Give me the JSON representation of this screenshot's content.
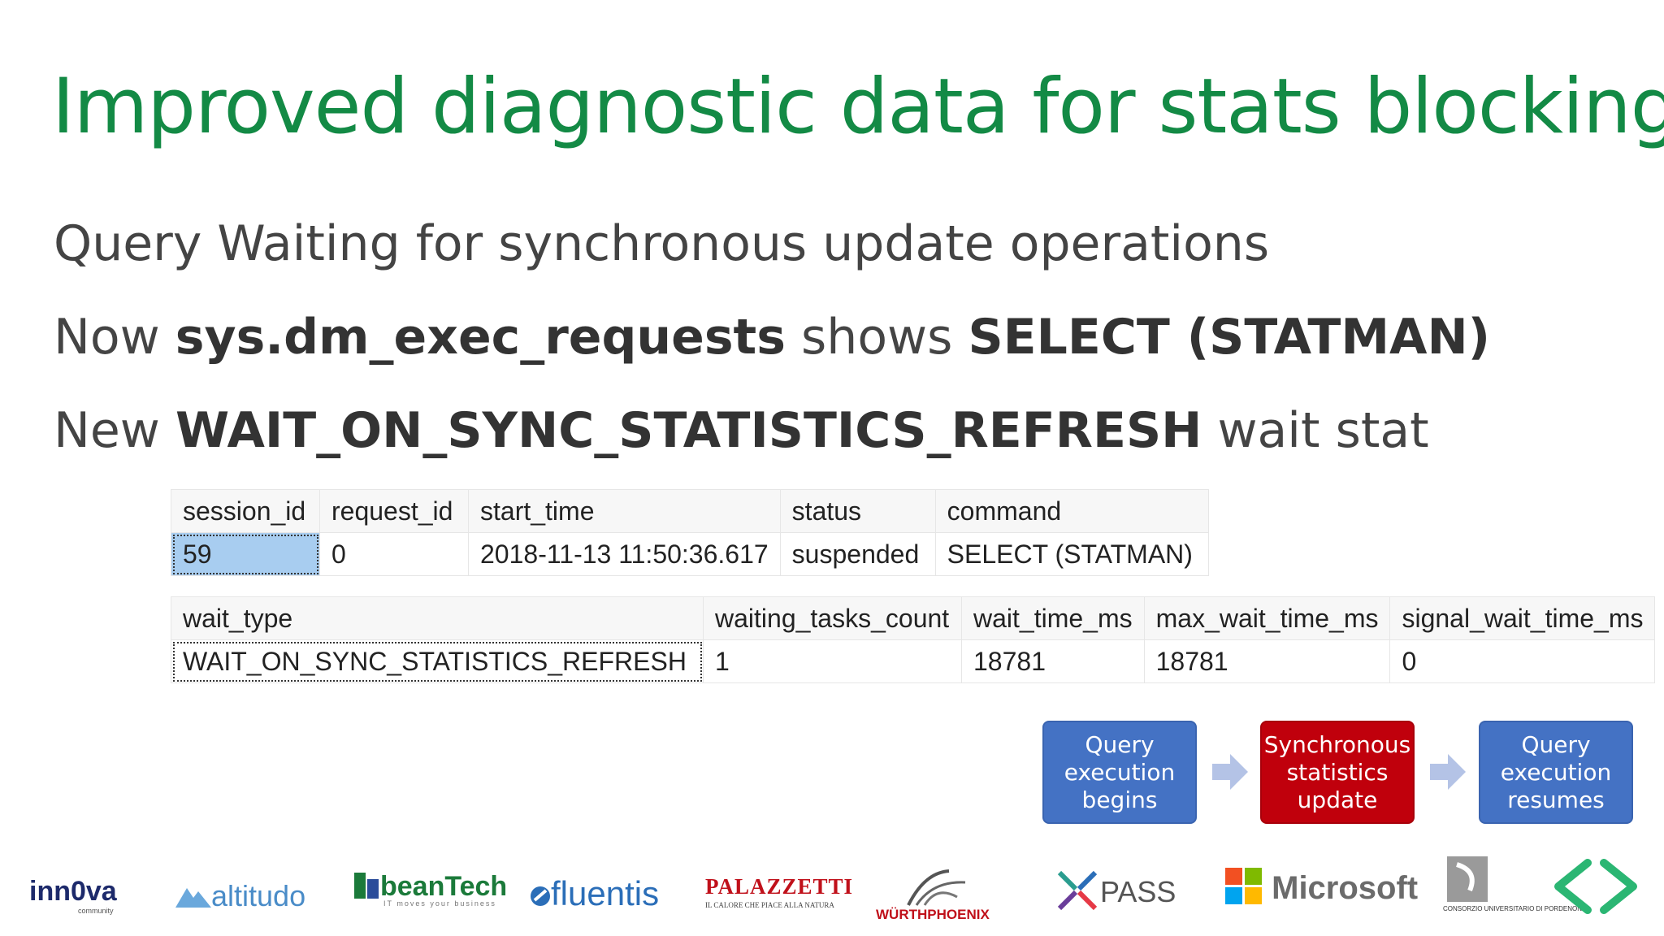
{
  "slide": {
    "title": "Improved diagnostic data for stats blocking",
    "bullets": [
      {
        "pre": "Query Waiting for synchronous update operations"
      },
      {
        "pre": "Now ",
        "bold1": "sys.dm_exec_requests",
        "mid": " shows ",
        "bold2": "SELECT (STATMAN)"
      },
      {
        "pre": "New ",
        "bold1": "WAIT_ON_SYNC_STATISTICS_REFRESH",
        "post": " wait stat"
      }
    ]
  },
  "requests_table": {
    "columns": [
      "session_id",
      "request_id",
      "start_time",
      "status",
      "command"
    ],
    "row": [
      "59",
      "0",
      "2018-11-13 11:50:36.617",
      "suspended",
      "SELECT (STATMAN)"
    ]
  },
  "waits_table": {
    "columns": [
      "wait_type",
      "waiting_tasks_count",
      "wait_time_ms",
      "max_wait_time_ms",
      "signal_wait_time_ms"
    ],
    "row": [
      "WAIT_ON_SYNC_STATISTICS_REFRESH",
      "1",
      "18781",
      "18781",
      "0"
    ]
  },
  "flow": {
    "steps": [
      "Query execution begins",
      "Synchronous statistics update",
      "Query execution resumes"
    ],
    "colors": {
      "blue": "#4472c4",
      "red": "#c0000c",
      "arrow": "#b4c3e6"
    }
  },
  "sponsors": {
    "innova": "inn0va",
    "innova_sub": "community",
    "altitudo": "altitudo",
    "beantech": "beanTech",
    "beantech_sub": "IT moves your business",
    "fluentis": "fluentis",
    "palazzetti": "PALAZZETTI",
    "palazzetti_sub": "IL CALORE CHE PIACE ALLA NATURA",
    "wurth": "WÜRTHPHOENIX",
    "pass": "PASS",
    "microsoft": "Microsoft",
    "consorzio": "CONSORZIO UNIVERSITARIO DI PORDENONE"
  },
  "theme": {
    "title_color": "#138a45",
    "text_color": "#444444"
  }
}
